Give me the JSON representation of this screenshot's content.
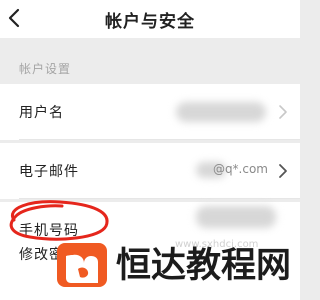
{
  "header": {
    "title": "帐户与安全",
    "back_icon": "chevron-left-icon"
  },
  "section": {
    "label": "帐户设置"
  },
  "rows": [
    {
      "label": "用户名",
      "value": "",
      "icon": "chevron-right-icon"
    },
    {
      "label": "电子邮件",
      "value": "@q*.com",
      "icon": "chevron-right-icon"
    },
    {
      "label": "手机号码",
      "value": "",
      "icon": "chevron-right-icon"
    },
    {
      "label": "修改密码",
      "value": "",
      "icon": "chevron-right-icon"
    }
  ],
  "watermark": {
    "brand_text": "恒达教程网",
    "url": "www.sxhdcj.com",
    "brand_color": "#f05a22"
  },
  "annotation": {
    "color": "#e5261c"
  }
}
